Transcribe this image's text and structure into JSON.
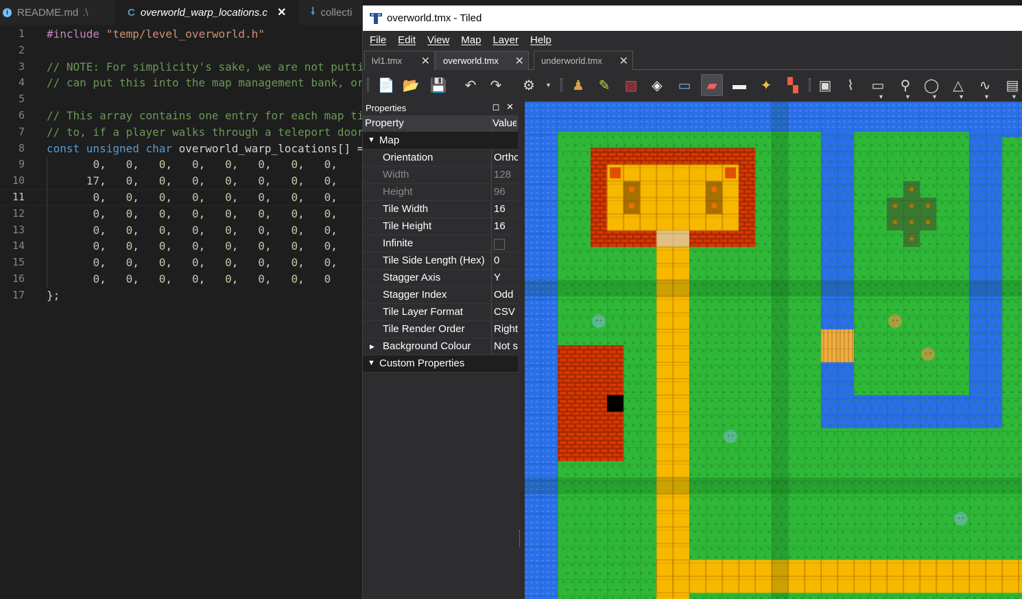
{
  "editor": {
    "tabs": [
      {
        "icon": "info-icon",
        "label": "README.md",
        "dim": ".\\"
      },
      {
        "icon": "c-file-icon",
        "label": "overworld_warp_locations.c",
        "active": true
      },
      {
        "icon": "download-icon",
        "label": "collecti"
      }
    ],
    "current_line": 11,
    "lines": [
      {
        "n": "1",
        "tokens": [
          [
            "pre",
            "#include "
          ],
          [
            "str",
            "\"temp/level_overworld.h\""
          ]
        ]
      },
      {
        "n": "2",
        "tokens": []
      },
      {
        "n": "3",
        "tokens": [
          [
            "com",
            "// NOTE: For simplicity's sake, we are not putti"
          ]
        ]
      },
      {
        "n": "4",
        "tokens": [
          [
            "com",
            "// can put this into the map management bank, or"
          ]
        ]
      },
      {
        "n": "5",
        "tokens": []
      },
      {
        "n": "6",
        "tokens": [
          [
            "com",
            "// This array contains one entry for each map ti"
          ]
        ]
      },
      {
        "n": "7",
        "tokens": [
          [
            "com",
            "// to, if a player walks through a teleport door"
          ]
        ]
      },
      {
        "n": "8",
        "tokens": [
          [
            "kw",
            "const unsigned char "
          ],
          [
            "id",
            "overworld_warp_locations"
          ],
          [
            "pun",
            "[] ="
          ]
        ]
      },
      {
        "n": "9",
        "tokens": [
          [
            "num",
            "0"
          ],
          [
            "pun",
            ",   "
          ],
          [
            "num",
            "0"
          ],
          [
            "pun",
            ",   "
          ],
          [
            "num",
            "0"
          ],
          [
            "pun",
            ",   "
          ],
          [
            "num",
            "0"
          ],
          [
            "pun",
            ",   "
          ],
          [
            "num",
            "0"
          ],
          [
            "pun",
            ",   "
          ],
          [
            "num",
            "0"
          ],
          [
            "pun",
            ",   "
          ],
          [
            "num",
            "0"
          ],
          [
            "pun",
            ",   "
          ],
          [
            "num",
            "0"
          ],
          [
            "pun",
            ","
          ]
        ],
        "indent": "       "
      },
      {
        "n": "10",
        "tokens": [
          [
            "num",
            "17"
          ],
          [
            "pun",
            ",   "
          ],
          [
            "num",
            "0"
          ],
          [
            "pun",
            ",   "
          ],
          [
            "num",
            "0"
          ],
          [
            "pun",
            ",   "
          ],
          [
            "num",
            "0"
          ],
          [
            "pun",
            ",   "
          ],
          [
            "num",
            "0"
          ],
          [
            "pun",
            ",   "
          ],
          [
            "num",
            "0"
          ],
          [
            "pun",
            ",   "
          ],
          [
            "num",
            "0"
          ],
          [
            "pun",
            ",   "
          ],
          [
            "num",
            "0"
          ],
          [
            "pun",
            ","
          ]
        ],
        "indent": "      "
      },
      {
        "n": "11",
        "tokens": [
          [
            "num",
            "0"
          ],
          [
            "pun",
            ",   "
          ],
          [
            "num",
            "0"
          ],
          [
            "pun",
            ",   "
          ],
          [
            "num",
            "0"
          ],
          [
            "pun",
            ",   "
          ],
          [
            "num",
            "0"
          ],
          [
            "pun",
            ",   "
          ],
          [
            "num",
            "0"
          ],
          [
            "pun",
            ",   "
          ],
          [
            "num",
            "0"
          ],
          [
            "pun",
            ",   "
          ],
          [
            "num",
            "0"
          ],
          [
            "pun",
            ",   "
          ],
          [
            "num",
            "0"
          ],
          [
            "pun",
            ","
          ]
        ],
        "indent": "       "
      },
      {
        "n": "12",
        "tokens": [
          [
            "num",
            "0"
          ],
          [
            "pun",
            ",   "
          ],
          [
            "num",
            "0"
          ],
          [
            "pun",
            ",   "
          ],
          [
            "num",
            "0"
          ],
          [
            "pun",
            ",   "
          ],
          [
            "num",
            "0"
          ],
          [
            "pun",
            ",   "
          ],
          [
            "num",
            "0"
          ],
          [
            "pun",
            ",   "
          ],
          [
            "num",
            "0"
          ],
          [
            "pun",
            ",   "
          ],
          [
            "num",
            "0"
          ],
          [
            "pun",
            ",   "
          ],
          [
            "num",
            "0"
          ],
          [
            "pun",
            ","
          ]
        ],
        "indent": "       "
      },
      {
        "n": "13",
        "tokens": [
          [
            "num",
            "0"
          ],
          [
            "pun",
            ",   "
          ],
          [
            "num",
            "0"
          ],
          [
            "pun",
            ",   "
          ],
          [
            "num",
            "0"
          ],
          [
            "pun",
            ",   "
          ],
          [
            "num",
            "0"
          ],
          [
            "pun",
            ",   "
          ],
          [
            "num",
            "0"
          ],
          [
            "pun",
            ",   "
          ],
          [
            "num",
            "0"
          ],
          [
            "pun",
            ",   "
          ],
          [
            "num",
            "0"
          ],
          [
            "pun",
            ",   "
          ],
          [
            "num",
            "0"
          ],
          [
            "pun",
            ","
          ]
        ],
        "indent": "       "
      },
      {
        "n": "14",
        "tokens": [
          [
            "num",
            "0"
          ],
          [
            "pun",
            ",   "
          ],
          [
            "num",
            "0"
          ],
          [
            "pun",
            ",   "
          ],
          [
            "num",
            "0"
          ],
          [
            "pun",
            ",   "
          ],
          [
            "num",
            "0"
          ],
          [
            "pun",
            ",   "
          ],
          [
            "num",
            "0"
          ],
          [
            "pun",
            ",   "
          ],
          [
            "num",
            "0"
          ],
          [
            "pun",
            ",   "
          ],
          [
            "num",
            "0"
          ],
          [
            "pun",
            ",   "
          ],
          [
            "num",
            "0"
          ],
          [
            "pun",
            ","
          ]
        ],
        "indent": "       "
      },
      {
        "n": "15",
        "tokens": [
          [
            "num",
            "0"
          ],
          [
            "pun",
            ",   "
          ],
          [
            "num",
            "0"
          ],
          [
            "pun",
            ",   "
          ],
          [
            "num",
            "0"
          ],
          [
            "pun",
            ",   "
          ],
          [
            "num",
            "0"
          ],
          [
            "pun",
            ",   "
          ],
          [
            "num",
            "0"
          ],
          [
            "pun",
            ",   "
          ],
          [
            "num",
            "0"
          ],
          [
            "pun",
            ",   "
          ],
          [
            "num",
            "0"
          ],
          [
            "pun",
            ",   "
          ],
          [
            "num",
            "0"
          ],
          [
            "pun",
            ","
          ]
        ],
        "indent": "       "
      },
      {
        "n": "16",
        "tokens": [
          [
            "num",
            "0"
          ],
          [
            "pun",
            ",   "
          ],
          [
            "num",
            "0"
          ],
          [
            "pun",
            ",   "
          ],
          [
            "num",
            "0"
          ],
          [
            "pun",
            ",   "
          ],
          [
            "num",
            "0"
          ],
          [
            "pun",
            ",   "
          ],
          [
            "num",
            "0"
          ],
          [
            "pun",
            ",   "
          ],
          [
            "num",
            "0"
          ],
          [
            "pun",
            ",   "
          ],
          [
            "num",
            "0"
          ],
          [
            "pun",
            ",   "
          ],
          [
            "num",
            "0"
          ]
        ],
        "indent": "       "
      },
      {
        "n": "17",
        "tokens": [
          [
            "pun",
            "};"
          ]
        ]
      }
    ]
  },
  "tiled": {
    "window_title": "overworld.tmx - Tiled",
    "menu": [
      "File",
      "Edit",
      "View",
      "Map",
      "Layer",
      "Help"
    ],
    "doc_tabs": [
      {
        "label": "lvl1.tmx"
      },
      {
        "label": "overworld.tmx",
        "active": true
      },
      {
        "label": "underworld.tmx"
      }
    ],
    "toolbar_icons": [
      "new-map-icon",
      "open-file-icon",
      "save-icon",
      "undo-icon",
      "redo-icon",
      "commands-icon",
      "stamp-brush-icon",
      "terrain-brush-icon",
      "wang-brush-icon",
      "bucket-fill-icon",
      "shape-fill-icon",
      "eraser-icon",
      "rectangle-select-icon",
      "magic-wand-icon",
      "select-same-tile-icon",
      "select-objects-icon",
      "edit-polygons-icon",
      "insert-rectangle-icon",
      "insert-point-icon",
      "insert-ellipse-icon",
      "insert-polygon-icon",
      "insert-polyline-icon",
      "insert-tile-icon"
    ],
    "properties_panel": {
      "title": "Properties",
      "col_property": "Property",
      "col_value": "Value",
      "group_map": "Map",
      "rows": [
        {
          "name": "Orientation",
          "value": "Orthc"
        },
        {
          "name": "Width",
          "value": "128",
          "dim": true
        },
        {
          "name": "Height",
          "value": "96",
          "dim": true
        },
        {
          "name": "Tile Width",
          "value": "16"
        },
        {
          "name": "Tile Height",
          "value": "16"
        },
        {
          "name": "Infinite",
          "value": "",
          "checkbox": true
        },
        {
          "name": "Tile Side Length (Hex)",
          "value": "0"
        },
        {
          "name": "Stagger Axis",
          "value": "Y"
        },
        {
          "name": "Stagger Index",
          "value": "Odd"
        },
        {
          "name": "Tile Layer Format",
          "value": "CSV"
        },
        {
          "name": "Tile Render Order",
          "value": "Right"
        },
        {
          "name": "Background Colour",
          "value": "Not s",
          "expandable": true
        }
      ],
      "group_custom": "Custom Properties"
    },
    "colors": {
      "water": "#2a6fe8",
      "grass": "#2fb838",
      "path": "#f8b800",
      "brick": "#d83800",
      "grid_shade": "#1a8a24"
    }
  }
}
